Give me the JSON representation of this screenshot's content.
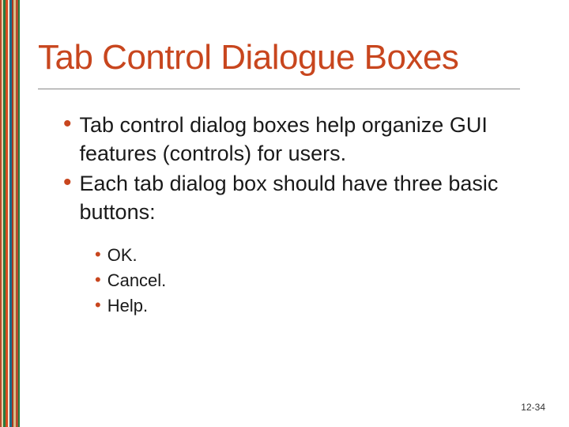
{
  "title": "Tab Control Dialogue Boxes",
  "bullets": [
    {
      "text": "Tab control dialog boxes help organize GUI features (controls) for users."
    },
    {
      "text": "Each tab dialog box should have three basic buttons:"
    }
  ],
  "sub_bullets": [
    {
      "text": "OK."
    },
    {
      "text": "Cancel."
    },
    {
      "text": "Help."
    }
  ],
  "page_number": "12-34"
}
